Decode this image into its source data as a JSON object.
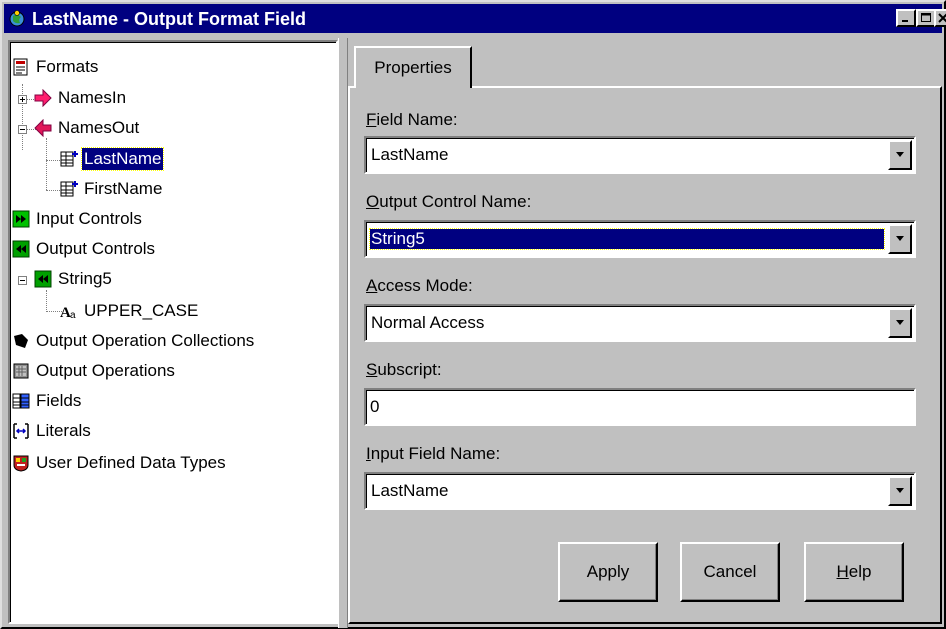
{
  "window": {
    "title": "LastName - Output Format Field",
    "titlebar_color": "#000080",
    "icons": [
      "minimize-icon",
      "maximize-icon",
      "close-icon"
    ]
  },
  "tree": {
    "items": [
      {
        "label": "Formats",
        "icon": "formats-icon"
      },
      {
        "label": "NamesIn",
        "icon": "arrow-in-icon",
        "expander": "+"
      },
      {
        "label": "NamesOut",
        "icon": "arrow-out-icon",
        "expander": "-"
      },
      {
        "label": "LastName",
        "icon": "field-icon",
        "selected": true
      },
      {
        "label": "FirstName",
        "icon": "field-icon"
      },
      {
        "label": "Input Controls",
        "icon": "input-controls-icon"
      },
      {
        "label": "Output Controls",
        "icon": "output-controls-icon"
      },
      {
        "label": "String5",
        "icon": "output-control-icon",
        "expander": "-"
      },
      {
        "label": "UPPER_CASE",
        "icon": "operation-text-icon"
      },
      {
        "label": "Output Operation Collections",
        "icon": "collection-icon"
      },
      {
        "label": "Output Operations",
        "icon": "operations-icon"
      },
      {
        "label": "Fields",
        "icon": "fields-icon"
      },
      {
        "label": "Literals",
        "icon": "literals-icon"
      },
      {
        "label": "User Defined Data Types",
        "icon": "udt-icon"
      }
    ]
  },
  "panel": {
    "tab_label": "Properties",
    "field_name": {
      "label_u": "F",
      "label_rest": "ield Name:",
      "value": "LastName"
    },
    "output_control_name": {
      "label_u": "O",
      "label_rest": "utput Control Name:",
      "value": "String5"
    },
    "access_mode": {
      "label_u": "A",
      "label_rest": "ccess Mode:",
      "value": "Normal Access"
    },
    "subscript": {
      "label_u": "S",
      "label_rest": "ubscript:",
      "value": "0"
    },
    "input_field_name": {
      "label_u": "I",
      "label_rest": "nput Field Name:",
      "value": "LastName"
    },
    "buttons": {
      "apply": "Apply",
      "cancel": "Cancel",
      "help_u": "H",
      "help_rest": "elp"
    }
  }
}
